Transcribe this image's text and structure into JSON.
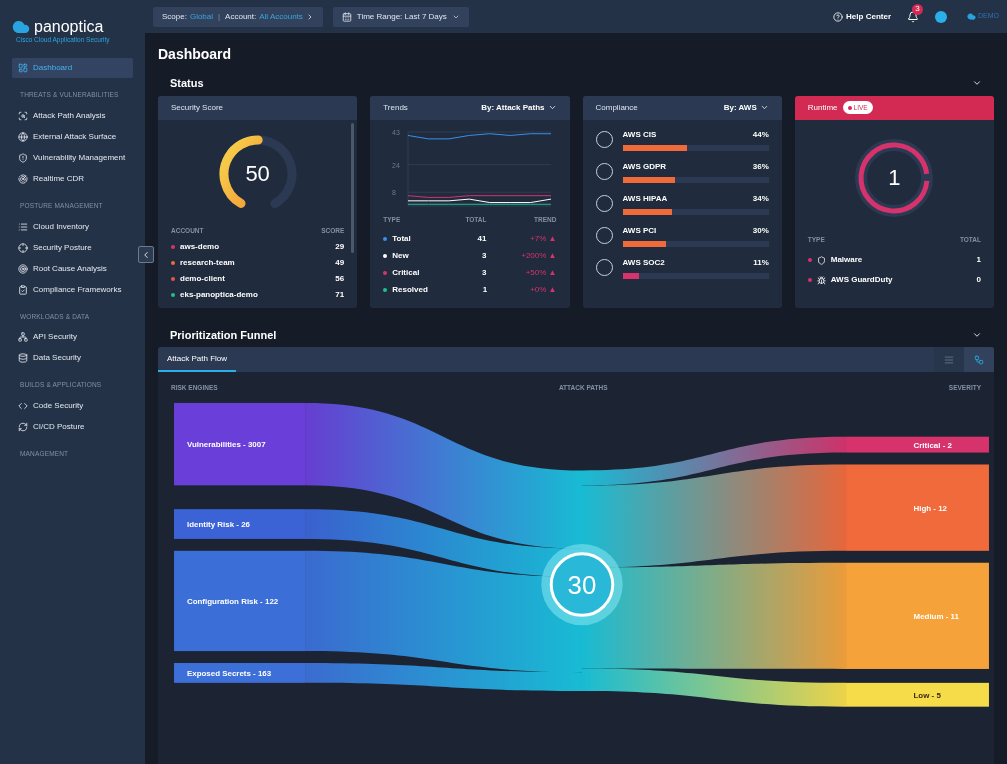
{
  "sidebar": {
    "logo": {
      "name": "panoptica",
      "tagline": "Cisco Cloud Application Security"
    },
    "nav": [
      {
        "kind": "item",
        "label": "Dashboard",
        "selected": true
      },
      {
        "kind": "heading",
        "label": "THREATS & VULNERABILITIES"
      },
      {
        "kind": "item",
        "label": "Attack Path Analysis",
        "selected": false
      },
      {
        "kind": "item",
        "label": "External Attack Surface",
        "selected": false
      },
      {
        "kind": "item",
        "label": "Vulnerability Management",
        "selected": false
      },
      {
        "kind": "item",
        "label": "Realtime CDR",
        "selected": false
      },
      {
        "kind": "heading",
        "label": "POSTURE MANAGEMENT"
      },
      {
        "kind": "item",
        "label": "Cloud Inventory",
        "selected": false
      },
      {
        "kind": "item",
        "label": "Security Posture",
        "selected": false
      },
      {
        "kind": "item",
        "label": "Root Cause Analysis",
        "selected": false
      },
      {
        "kind": "item",
        "label": "Compliance Frameworks",
        "selected": false
      },
      {
        "kind": "heading",
        "label": "WORKLOADS & DATA"
      },
      {
        "kind": "item",
        "label": "API Security",
        "selected": false
      },
      {
        "kind": "item",
        "label": "Data Security",
        "selected": false
      },
      {
        "kind": "heading",
        "label": "BUILDS & APPLICATIONS"
      },
      {
        "kind": "item",
        "label": "Code Security",
        "selected": false
      },
      {
        "kind": "item",
        "label": "CI/CD Posture",
        "selected": false
      },
      {
        "kind": "heading",
        "label": "MANAGEMENT"
      }
    ]
  },
  "top_bar": {
    "scope_label": "Scope:",
    "scope_value": "Global",
    "separator": "|",
    "account_label": "Account:",
    "account_value": "All Accounts",
    "time_range": "Time Range: Last 7 Days",
    "help": "Help Center",
    "notifications": "3",
    "brand": "DEMO"
  },
  "page_title": "Dashboard",
  "status": {
    "title": "Status",
    "security_score": {
      "title": "Security Score",
      "score": "50",
      "level": 0.5,
      "columns": [
        "ACCOUNT",
        "SCORE"
      ],
      "rows": [
        {
          "name": "aws-demo",
          "score": "29",
          "color": "#d6336c"
        },
        {
          "name": "research-team",
          "score": "49",
          "color": "#f06a3c"
        },
        {
          "name": "demo-client",
          "score": "56",
          "color": "#e8554a"
        },
        {
          "name": "eks-panoptica-demo",
          "score": "71",
          "color": "#1fbf8f"
        }
      ]
    },
    "trends": {
      "title": "Trends",
      "by_label": "By:",
      "by_value": "Attack Paths",
      "chart_data": {
        "type": "line",
        "grid": true,
        "ylim": [
          0,
          43
        ],
        "yticks": [
          8,
          24,
          43
        ],
        "series": [
          {
            "color": "#3b8fe8",
            "values": [
              41,
              39,
              39,
              41,
              42,
              41,
              42,
              42
            ]
          },
          {
            "color": "#ffffff",
            "values": [
              3,
              3,
              3,
              4,
              2,
              2,
              2,
              4
            ]
          },
          {
            "color": "#d6336c",
            "values": [
              6,
              5,
              5,
              6,
              6,
              6,
              6,
              6
            ]
          },
          {
            "color": "#1fbf8f",
            "values": [
              1,
              1,
              1,
              1,
              1,
              1,
              1,
              1
            ]
          }
        ]
      },
      "columns": [
        "TYPE",
        "TOTAL",
        "TREND"
      ],
      "rows": [
        {
          "type": "Total",
          "total": "41",
          "trend": "+7% ▲",
          "color": "#3b8fe8"
        },
        {
          "type": "New",
          "total": "3",
          "trend": "+200% ▲",
          "color": "#ffffff"
        },
        {
          "type": "Critical",
          "total": "3",
          "trend": "+50% ▲",
          "color": "#d6336c"
        },
        {
          "type": "Resolved",
          "total": "1",
          "trend": "+0% ▲",
          "color": "#1fbf8f"
        }
      ]
    },
    "compliance": {
      "title": "Compliance",
      "by_label": "By:",
      "by_value": "AWS",
      "items": [
        {
          "name": "AWS CIS",
          "percent": "44%",
          "level": 0.44,
          "color": "#f06a3c"
        },
        {
          "name": "AWS GDPR",
          "percent": "36%",
          "level": 0.36,
          "color": "#f06a3c"
        },
        {
          "name": "AWS HIPAA",
          "percent": "34%",
          "level": 0.34,
          "color": "#f06a3c"
        },
        {
          "name": "AWS PCI",
          "percent": "30%",
          "level": 0.3,
          "color": "#f06a3c"
        },
        {
          "name": "AWS SOC2",
          "percent": "11%",
          "level": 0.11,
          "color": "#d6336c"
        }
      ]
    },
    "runtime": {
      "title": "Runtime",
      "badge": "LIVE",
      "count": "1",
      "columns": [
        "TYPE",
        "TOTAL"
      ],
      "rows": [
        {
          "type": "Malware",
          "total": "1"
        },
        {
          "type": "AWS GuardDuty",
          "total": "0"
        }
      ]
    }
  },
  "funnel": {
    "title": "Prioritization Funnel",
    "tabs": [
      {
        "label": "Attack Path Flow",
        "selected": true
      }
    ],
    "view_toggle": [
      {
        "kind": "list",
        "selected": false
      },
      {
        "kind": "flow",
        "selected": true
      }
    ],
    "columns": [
      "RISK ENGINES",
      "ATTACK PATHS",
      "SEVERITY"
    ],
    "sources": [
      "Vulnerabilities - 3007",
      "Identity Risk - 26",
      "Configuration Risk - 122",
      "Exposed Secrets - 163"
    ],
    "center": "30",
    "targets": [
      "Critical - 2",
      "High - 12",
      "Medium - 11",
      "Low - 5"
    ]
  }
}
